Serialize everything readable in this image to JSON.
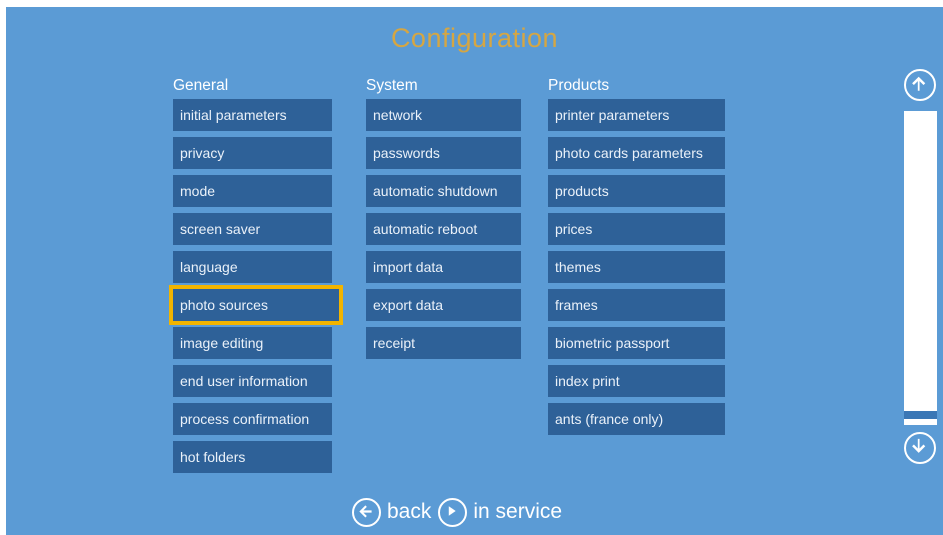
{
  "title": "Configuration",
  "columns": {
    "general": {
      "header": "General",
      "items": [
        "initial parameters",
        "privacy",
        "mode",
        "screen saver",
        "language",
        "photo sources",
        "image editing",
        "end user information",
        "process confirmation",
        "hot folders"
      ]
    },
    "system": {
      "header": "System",
      "items": [
        "network",
        "passwords",
        "automatic shutdown",
        "automatic reboot",
        "import data",
        "export data",
        "receipt"
      ]
    },
    "products": {
      "header": "Products",
      "items": [
        "printer parameters",
        "photo cards parameters",
        "products",
        "prices",
        "themes",
        "frames",
        "biometric passport",
        "index print",
        "ants (france only)"
      ]
    }
  },
  "selected_item": "photo sources",
  "footer": {
    "back_label": "back",
    "in_service_label": "in service"
  },
  "icons": {
    "scroll_up": "arrow-up-circle-icon",
    "scroll_down": "arrow-down-circle-icon",
    "back": "arrow-left-circle-icon",
    "in_service": "play-circle-icon"
  },
  "colors": {
    "background": "#5b9bd5",
    "button": "#2e6198",
    "title": "#f4a91f",
    "highlight": "#f2b400"
  }
}
